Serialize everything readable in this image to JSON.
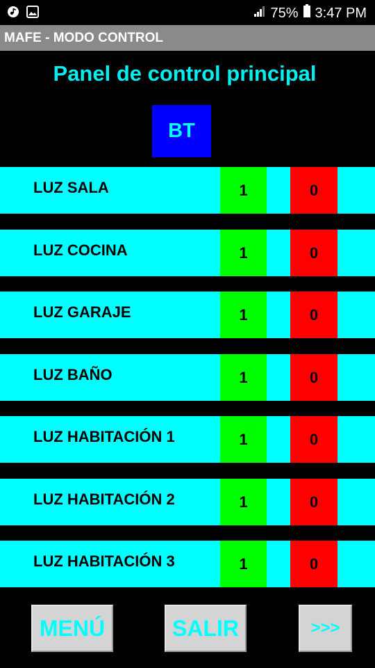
{
  "status_bar": {
    "battery": "75%",
    "time": "3:47 PM",
    "icons": [
      "music-icon",
      "image-icon",
      "signal-icon",
      "battery-icon"
    ]
  },
  "app": {
    "title": "MAFE - MODO CONTROL"
  },
  "panel": {
    "title": "Panel de control principal",
    "bt_label": "BT"
  },
  "rows": [
    {
      "label": "LUZ SALA",
      "on": "1",
      "off": "0"
    },
    {
      "label": "LUZ COCINA",
      "on": "1",
      "off": "0"
    },
    {
      "label": "LUZ GARAJE",
      "on": "1",
      "off": "0"
    },
    {
      "label": "LUZ BAÑO",
      "on": "1",
      "off": "0"
    },
    {
      "label": "LUZ HABITACIÓN 1",
      "on": "1",
      "off": "0"
    },
    {
      "label": "LUZ HABITACIÓN 2",
      "on": "1",
      "off": "0"
    },
    {
      "label": "LUZ HABITACIÓN 3",
      "on": "1",
      "off": "0"
    }
  ],
  "footer": {
    "menu_label": "MENÚ",
    "exit_label": "SALIR",
    "next_label": ">>>"
  },
  "colors": {
    "row_bg": "#00ffff",
    "on_bg": "#00ff00",
    "off_bg": "#ff0000",
    "bt_bg": "#0000ff",
    "title_color": "#00f0f0"
  }
}
